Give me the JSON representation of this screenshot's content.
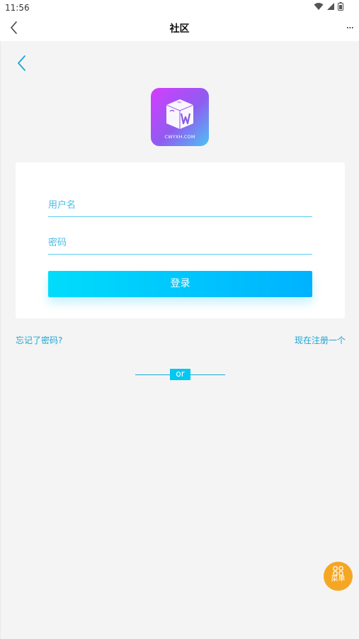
{
  "status_bar": {
    "time": "11:56",
    "icons": [
      "wifi-icon",
      "signal-icon",
      "battery-icon"
    ]
  },
  "nav_bar": {
    "title": "社区",
    "more_label": "..."
  },
  "logo": {
    "caption": "CWYXH.COM",
    "gradient": [
      "#d53cff",
      "#8f5cf0",
      "#4cc2f5"
    ]
  },
  "login_form": {
    "username_placeholder": "用户名",
    "password_placeholder": "密码",
    "login_label": "登录"
  },
  "links": {
    "forgot_password": "忘记了密码?",
    "register": "现在注册一个"
  },
  "divider": {
    "label": "or"
  },
  "menu_button": {
    "label": "菜单"
  },
  "colors": {
    "accent": "#00b2ff",
    "link": "#1aa6d6",
    "fab": "#f5a623",
    "background": "#f4f4f4"
  }
}
